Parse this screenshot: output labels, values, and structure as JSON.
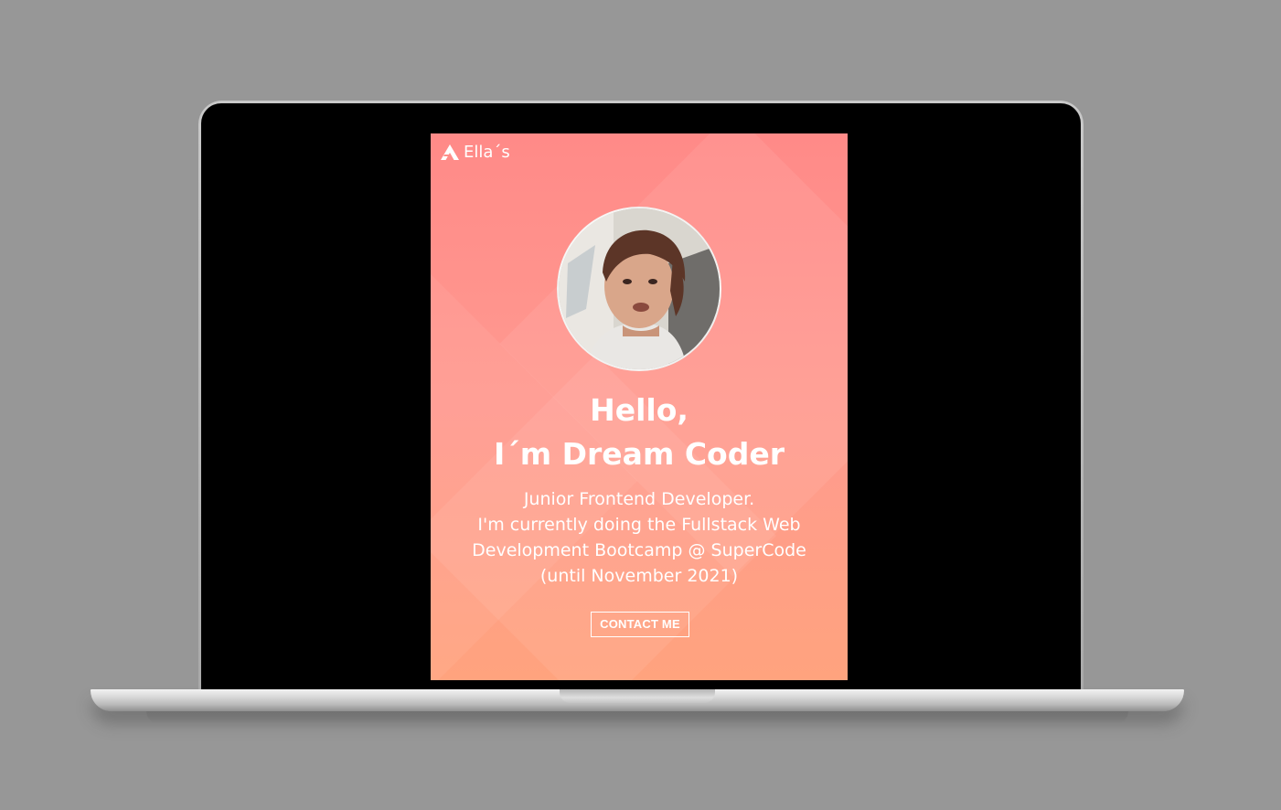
{
  "site": {
    "brand_name": "Ella´s",
    "brand_icon": "logo-a-icon"
  },
  "hero": {
    "heading_line1": "Hello,",
    "heading_line2": "I´m Dream Coder",
    "bio_line1": "Junior Frontend Developer.",
    "bio_line2": "I'm currently doing the Fullstack Web",
    "bio_line3": "Development Bootcamp @ SuperCode",
    "bio_line4": "(until November 2021)",
    "contact_label": "CONTACT ME",
    "avatar": "profile-photo"
  },
  "colors": {
    "background": "#979797",
    "gradient_top": "#ff8a88",
    "gradient_bottom": "#ffa37e",
    "text": "#ffffff"
  }
}
